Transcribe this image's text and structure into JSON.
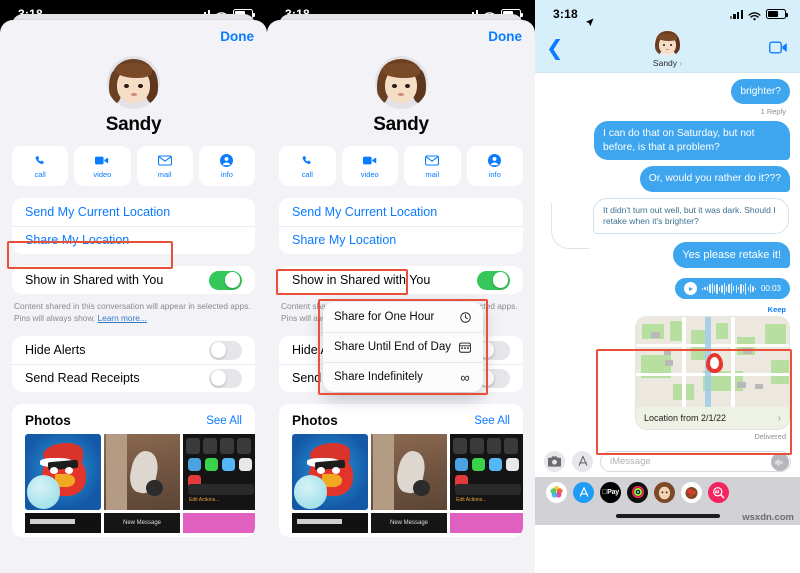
{
  "panels": {
    "one": {
      "status": {
        "time": "3:18"
      },
      "sheet": {
        "done_label": "Done",
        "contact_name": "Sandy",
        "actions": [
          {
            "label": "call",
            "icon": "phone-icon"
          },
          {
            "label": "video",
            "icon": "video-camera-icon"
          },
          {
            "label": "mail",
            "icon": "envelope-icon"
          },
          {
            "label": "info",
            "icon": "person-circle-icon"
          }
        ],
        "location_rows": [
          {
            "label": "Send My Current Location",
            "highlighted": true
          },
          {
            "label": "Share My Location",
            "highlighted": false
          }
        ],
        "shared_row": {
          "label": "Show in Shared with You",
          "toggle": "on"
        },
        "note_text": "Content shared in this conversation will appear in selected apps. Pins will always show. ",
        "note_link": "Learn more...",
        "switch_rows": [
          {
            "label": "Hide Alerts",
            "toggle": "off"
          },
          {
            "label": "Send Read Receipts",
            "toggle": "off"
          }
        ],
        "photos": {
          "title": "Photos",
          "see_all": "See All"
        }
      }
    },
    "two": {
      "status": {
        "time": "3:18"
      },
      "sheet": {
        "done_label": "Done",
        "contact_name": "Sandy",
        "actions": [
          {
            "label": "call",
            "icon": "phone-icon"
          },
          {
            "label": "video",
            "icon": "video-camera-icon"
          },
          {
            "label": "mail",
            "icon": "envelope-icon"
          },
          {
            "label": "info",
            "icon": "person-circle-icon"
          }
        ],
        "location_rows": [
          {
            "label": "Send My Current Location",
            "highlighted": false
          },
          {
            "label": "Share My Location",
            "highlighted": true
          }
        ],
        "shared_row": {
          "label": "Show in Shared with You",
          "toggle": "on"
        },
        "note_text": "Content shared in this conversation will appear in selected apps. Pins will always show. ",
        "note_link": "Learn more...",
        "switch_rows": [
          {
            "label": "Hide Alerts",
            "toggle": "off"
          },
          {
            "label": "Send Read Receipts",
            "toggle": "off"
          }
        ],
        "photos": {
          "title": "Photos",
          "see_all": "See All"
        }
      },
      "popup_menu": {
        "items": [
          {
            "label": "Share for One Hour",
            "icon": "clock-icon",
            "glyph": "◴"
          },
          {
            "label": "Share Until End of Day",
            "icon": "calendar-icon",
            "glyph": "Ὄ5"
          },
          {
            "label": "Share Indefinitely",
            "icon": "infinity-icon",
            "glyph": "∞"
          }
        ]
      }
    },
    "three": {
      "status": {
        "time": "3:18",
        "location_arrow": "location-arrow-icon"
      },
      "header": {
        "back_icon": "chevron-left-icon",
        "facetime_icon": "video-camera-icon",
        "contact_name": "Sandy",
        "chevron": "›"
      },
      "messages": [
        {
          "from": "me",
          "text": "brighter?"
        },
        {
          "meta": "1 Reply"
        },
        {
          "from": "me",
          "text": "I can do that on Saturday, but not before, is that a problem?"
        },
        {
          "from": "me",
          "text": "Or, would you rather do it???"
        },
        {
          "from": "them",
          "text": "It didn't turn out well, but it was dark. Should I retake when it's brighter?"
        },
        {
          "from": "me",
          "text": "Yes please retake it!"
        }
      ],
      "voice_message": {
        "duration": "00:03",
        "keep_label": "Keep",
        "play_icon": "play-icon"
      },
      "map_message": {
        "label": "Location from 2/1/22",
        "status": "Delivered",
        "pin_icon": "map-pin-icon"
      },
      "input_bar": {
        "camera_icon": "camera-icon",
        "appstore_icon": "app-store-icon",
        "placeholder": "iMessage",
        "audio_icon": "audio-wave-icon"
      },
      "app_drawer": [
        {
          "name": "photos-app-icon",
          "color": "#ffffff"
        },
        {
          "name": "app-store-app-icon",
          "color": "#1f9cf5"
        },
        {
          "name": "apple-pay-app-icon",
          "color": "#000000"
        },
        {
          "name": "fitness-app-icon",
          "color": "#111111"
        },
        {
          "name": "memoji-app-icon",
          "color": "#b07a4e"
        },
        {
          "name": "memoji-two-app-icon",
          "color": "#ffffff"
        },
        {
          "name": "images-app-icon",
          "color": "#f4245e"
        }
      ],
      "watermark": "wsxdn.com"
    }
  },
  "colors": {
    "accent_blue": "#0a7cff",
    "bubble_blue": "#3ea6ee",
    "toggle_green": "#34c759",
    "highlight_red": "#e8503a",
    "sheet_bg": "#f2f2f7"
  }
}
